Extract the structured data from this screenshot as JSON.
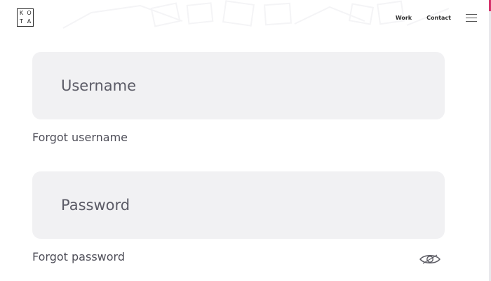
{
  "brand": {
    "logo_letters": [
      "K",
      "O",
      "T",
      "A"
    ]
  },
  "nav": {
    "work_label": "Work",
    "contact_label": "Contact",
    "menu_icon": "hamburger-menu-icon"
  },
  "login_form": {
    "username": {
      "placeholder": "Username",
      "value": ""
    },
    "forgot_username_label": "Forgot username",
    "password": {
      "placeholder": "Password",
      "value": ""
    },
    "forgot_password_label": "Forgot password",
    "show_password_icon": "eye-icon"
  },
  "colors": {
    "field_background": "#f1f1f3",
    "text": "#4e4e58",
    "accent_edge": "#d6336c"
  }
}
